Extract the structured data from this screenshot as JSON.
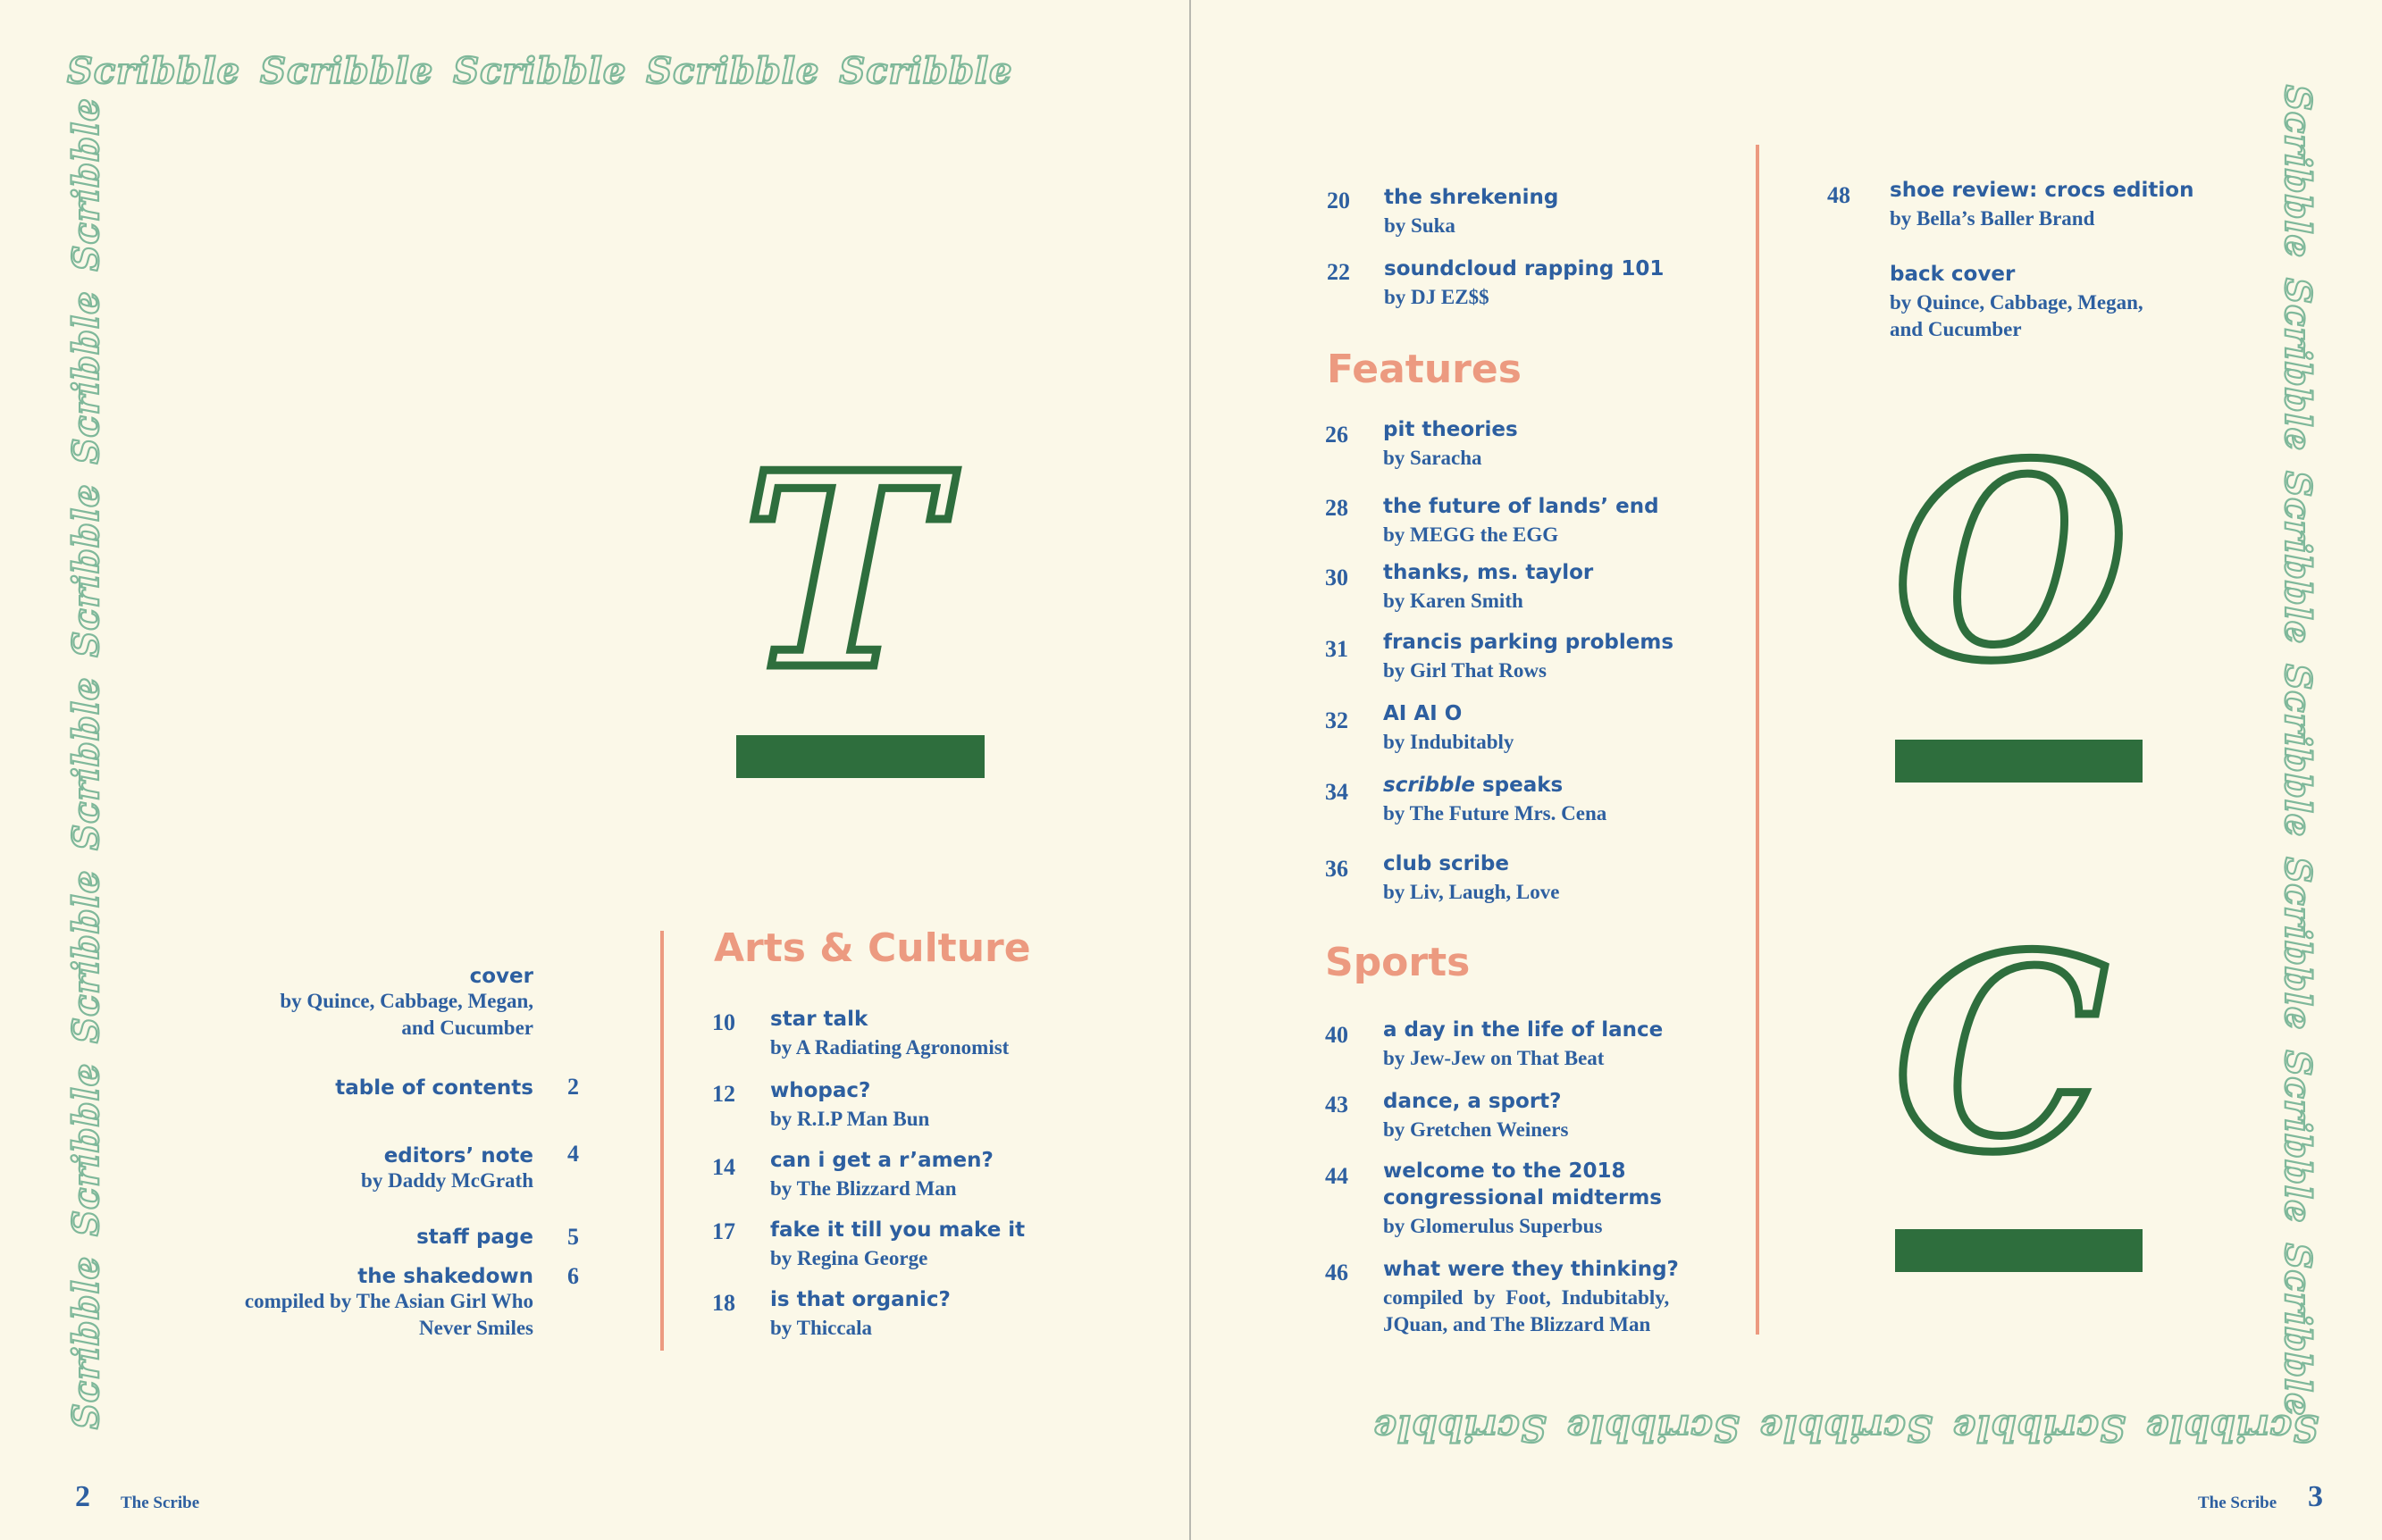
{
  "banner_word": "Scribble",
  "left_page": {
    "big_letter": "T",
    "intro": [
      {
        "title": "cover",
        "author": "by Quince, Cabbage, Megan,",
        "author2": "and Cucumber",
        "page": ""
      },
      {
        "title": "table of contents",
        "author": "",
        "author2": "",
        "page": "2"
      },
      {
        "title": "editors’ note",
        "author": "by Daddy McGrath",
        "author2": "",
        "page": "4"
      },
      {
        "title": "staff page",
        "author": "",
        "author2": "",
        "page": "5"
      },
      {
        "title": "the shakedown",
        "author": "compiled by The Asian Girl Who",
        "author2": "Never Smiles",
        "page": "6"
      }
    ],
    "arts_heading": "Arts & Culture",
    "arts": [
      {
        "page": "10",
        "title": "star talk",
        "author": "by A Radiating Agronomist"
      },
      {
        "page": "12",
        "title": "whopac?",
        "author": "by R.I.P Man Bun"
      },
      {
        "page": "14",
        "title": "can i get a r’amen?",
        "author": "by The Blizzard Man"
      },
      {
        "page": "17",
        "title": "fake it till you make it",
        "author": "by Regina George"
      },
      {
        "page": "18",
        "title": "is that organic?",
        "author": "by Thiccala"
      }
    ],
    "footer_num": "2",
    "footer_name": "The Scribe"
  },
  "right_page": {
    "letter_o": "O",
    "letter_c": "C",
    "continued": [
      {
        "page": "20",
        "title": "the shrekening",
        "author": "by Suka"
      },
      {
        "page": "22",
        "title": "soundcloud rapping 101",
        "author": "by DJ EZ$$"
      }
    ],
    "features_heading": "Features",
    "features": [
      {
        "page": "26",
        "title": "pit theories",
        "author": "by Saracha"
      },
      {
        "page": "28",
        "title": "the future of lands’ end",
        "author": "by MEGG the EGG"
      },
      {
        "page": "30",
        "title": "thanks, ms. taylor",
        "author": "by Karen Smith"
      },
      {
        "page": "31",
        "title": "francis parking problems",
        "author": "by Girl That Rows"
      },
      {
        "page": "32",
        "title": "AI AI O",
        "author": "by Indubitably"
      },
      {
        "page": "34",
        "title_italic": "scribble",
        "title": " speaks",
        "author": "by The Future Mrs. Cena"
      },
      {
        "page": "36",
        "title": "club scribe",
        "author": "by Liv, Laugh, Love"
      }
    ],
    "sports_heading": "Sports",
    "sports": [
      {
        "page": "40",
        "title": "a day in the life of lance",
        "author": "by Jew-Jew on That Beat"
      },
      {
        "page": "43",
        "title": "dance, a sport?",
        "author": "by Gretchen Weiners"
      },
      {
        "page": "44",
        "title": "welcome to the 2018",
        "title2": "congressional midterms",
        "author": "by Glomerulus Superbus"
      },
      {
        "page": "46",
        "title": "what were they thinking?",
        "author": "compiled by Foot, Indubitably,",
        "author2": "JQuan, and The Blizzard Man"
      }
    ],
    "col2": [
      {
        "page": "48",
        "title": "shoe review: crocs edition",
        "author": "by Bella’s Baller Brand"
      },
      {
        "page": "",
        "title": "back cover",
        "author": "by Quince, Cabbage, Megan,",
        "author2": "and Cucumber"
      }
    ],
    "footer_num": "3",
    "footer_name": "The Scribe"
  }
}
